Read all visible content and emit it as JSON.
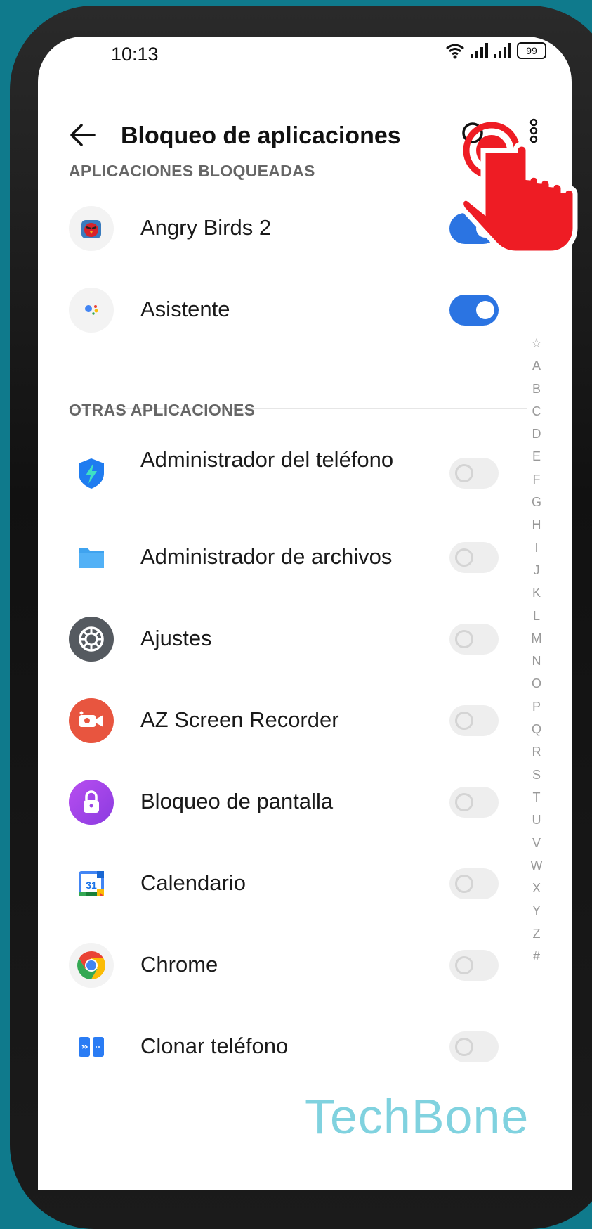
{
  "status_bar": {
    "time": "10:13",
    "battery": "99"
  },
  "app_bar": {
    "title": "Bloqueo de aplicaciones",
    "back_icon": "arrow-left-icon",
    "search_icon": "search-icon",
    "more_icon": "more-vertical-icon"
  },
  "sections": {
    "locked": {
      "header": "APLICACIONES BLOQUEADAS"
    },
    "others": {
      "header": "OTRAS APLICACIONES"
    }
  },
  "locked_apps": [
    {
      "name": "Angry Birds 2",
      "enabled": true
    },
    {
      "name": "Asistente",
      "enabled": true
    }
  ],
  "other_apps": [
    {
      "name": "Administrador del teléfono",
      "enabled": false
    },
    {
      "name": "Administrador de archivos",
      "enabled": false
    },
    {
      "name": "Ajustes",
      "enabled": false
    },
    {
      "name": "AZ Screen Recorder",
      "enabled": false
    },
    {
      "name": "Bloqueo de pantalla",
      "enabled": false
    },
    {
      "name": "Calendario",
      "enabled": false
    },
    {
      "name": "Chrome",
      "enabled": false
    },
    {
      "name": "Clonar teléfono",
      "enabled": false
    }
  ],
  "alpha_index": [
    "☆",
    "A",
    "B",
    "C",
    "D",
    "E",
    "F",
    "G",
    "H",
    "I",
    "J",
    "K",
    "L",
    "M",
    "N",
    "O",
    "P",
    "Q",
    "R",
    "S",
    "T",
    "U",
    "V",
    "W",
    "X",
    "Y",
    "Z",
    "#"
  ],
  "calendar_icon_day": "31",
  "watermark": "TechBone",
  "colors": {
    "accent": "#2b74e2",
    "tap_indicator": "#ee1c24",
    "background": "#0f7a8c"
  }
}
